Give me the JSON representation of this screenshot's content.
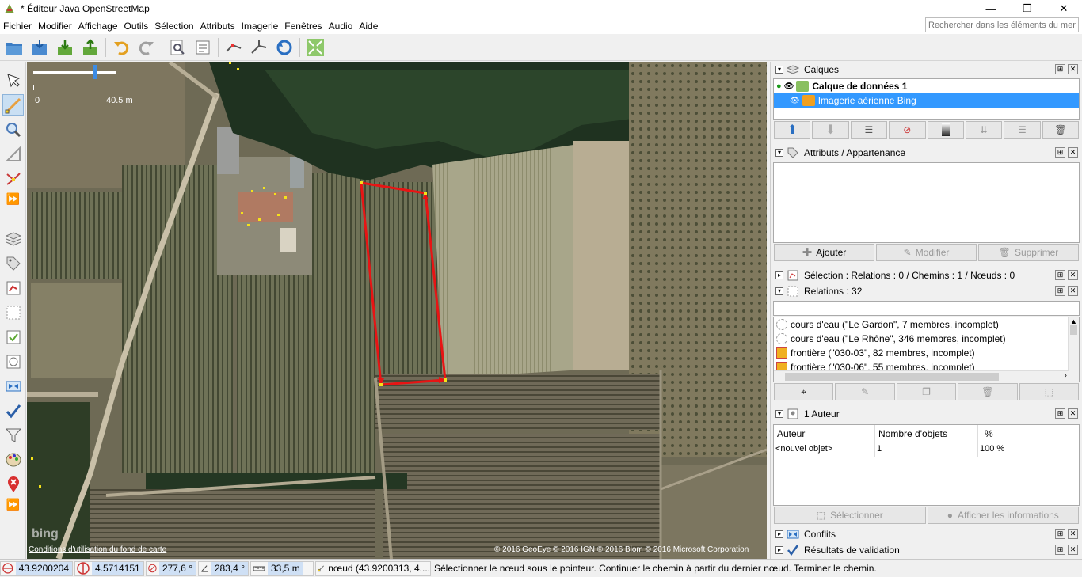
{
  "window": {
    "title": "* Éditeur Java OpenStreetMap",
    "minimize": "—",
    "maximize": "❐",
    "close": "✕"
  },
  "menu": {
    "items": [
      "Fichier",
      "Modifier",
      "Affichage",
      "Outils",
      "Sélection",
      "Attributs",
      "Imagerie",
      "Fenêtres",
      "Audio",
      "Aide"
    ],
    "search_placeholder": "Rechercher dans les éléments du menu"
  },
  "map": {
    "scale_start": "0",
    "scale_end": "40.5 m",
    "bing_logo": "bing",
    "terms_link": "Conditions d'utilisation du fond de carte",
    "attribution": "© 2016 GeoEye © 2016 IGN © 2016 Blom © 2016 Microsoft Corporation"
  },
  "panels": {
    "layers": {
      "title": "Calques",
      "items": [
        {
          "name": "Calque de données 1",
          "active": true
        },
        {
          "name": "Imagerie aérienne Bing",
          "selected": true
        }
      ]
    },
    "attributes": {
      "title": "Attributs / Appartenance",
      "add": "Ajouter",
      "edit": "Modifier",
      "delete": "Supprimer"
    },
    "selection": {
      "title": "Sélection : Relations : 0 / Chemins : 1 / Nœuds : 0"
    },
    "relations": {
      "title": "Relations : 32",
      "items": [
        "cours d'eau (\"Le Gardon\", 7 membres, incomplet)",
        "cours d'eau (\"Le Rhône\", 346 membres, incomplet)",
        "frontière (\"030-03\", 82 membres, incomplet)",
        "frontière (\"030-06\", 55 membres, incomplet)"
      ]
    },
    "authors": {
      "title": "1 Auteur",
      "columns": [
        "Auteur",
        "Nombre d'objets",
        "%"
      ],
      "rows": [
        [
          "<nouvel objet>",
          "1",
          "100 %"
        ]
      ],
      "select": "Sélectionner",
      "info": "Afficher les informations"
    },
    "conflicts": {
      "title": "Conflits"
    },
    "validation": {
      "title": "Résultats de validation"
    }
  },
  "status": {
    "lat": "43.9200204",
    "lon": "4.5714151",
    "heading": "277,6 °",
    "angle": "283,4 °",
    "distance": "33,5 m",
    "node": "nœud (43.9200313, 4....",
    "help": "Sélectionner le nœud sous le pointeur. Continuer le chemin à partir du dernier nœud. Terminer le chemin."
  }
}
